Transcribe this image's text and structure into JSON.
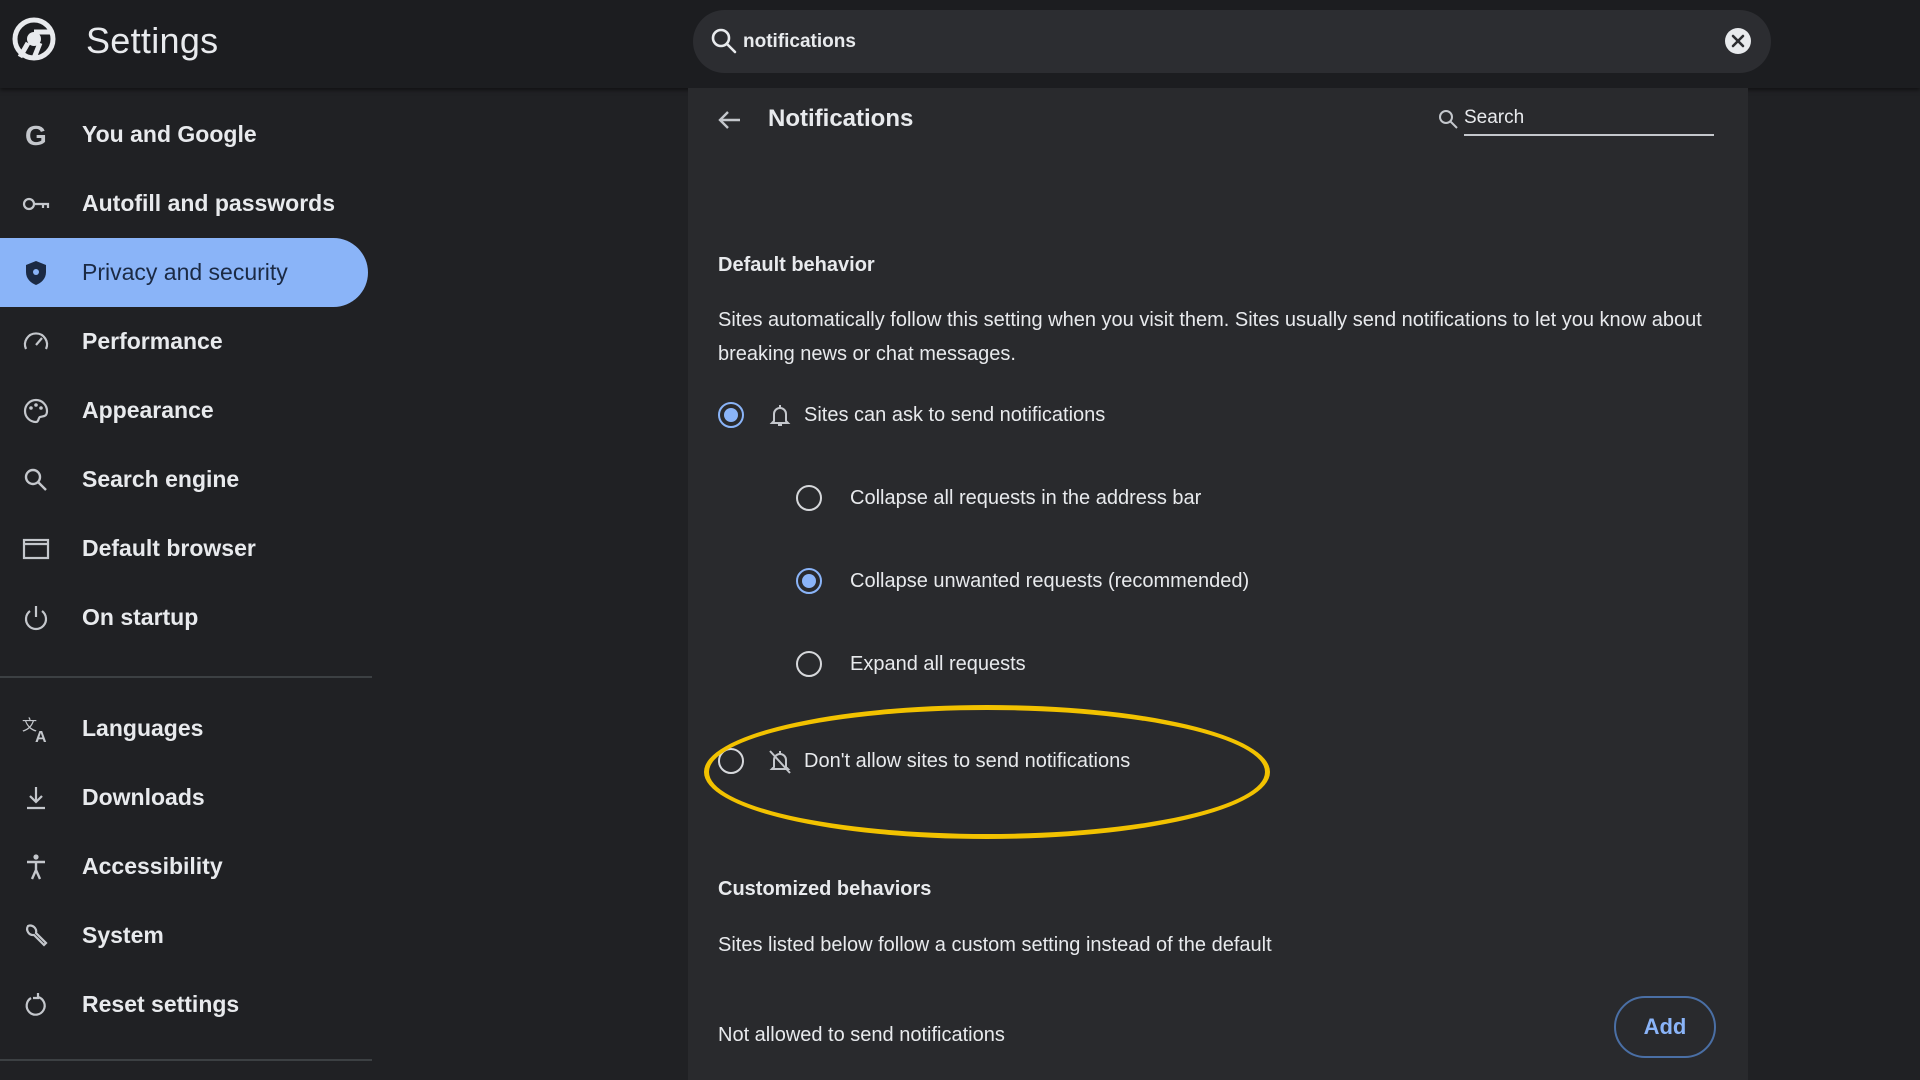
{
  "app": {
    "title": "Settings"
  },
  "search": {
    "value": "notifications"
  },
  "sidebar": {
    "items": [
      {
        "label": "You and Google",
        "icon": "google-icon"
      },
      {
        "label": "Autofill and passwords",
        "icon": "key-icon"
      },
      {
        "label": "Privacy and security",
        "icon": "shield-icon",
        "active": true
      },
      {
        "label": "Performance",
        "icon": "speedometer-icon"
      },
      {
        "label": "Appearance",
        "icon": "palette-icon"
      },
      {
        "label": "Search engine",
        "icon": "search-icon"
      },
      {
        "label": "Default browser",
        "icon": "browser-window-icon"
      },
      {
        "label": "On startup",
        "icon": "power-icon"
      }
    ],
    "items2": [
      {
        "label": "Languages",
        "icon": "translate-icon"
      },
      {
        "label": "Downloads",
        "icon": "download-icon"
      },
      {
        "label": "Accessibility",
        "icon": "accessibility-icon"
      },
      {
        "label": "System",
        "icon": "wrench-icon"
      },
      {
        "label": "Reset settings",
        "icon": "reset-icon"
      }
    ]
  },
  "page": {
    "title": "Notifications",
    "search_placeholder": "Search",
    "default_behavior": {
      "title": "Default behavior",
      "description": "Sites automatically follow this setting when you visit them. Sites usually send notifications to let you know about breaking news or chat messages.",
      "options": [
        {
          "label": "Sites can ask to send notifications",
          "selected": true
        },
        {
          "label": "Collapse all requests in the address bar",
          "selected": false
        },
        {
          "label": "Collapse unwanted requests (recommended)",
          "selected": true
        },
        {
          "label": "Expand all requests",
          "selected": false
        },
        {
          "label": "Don't allow sites to send notifications",
          "selected": false
        }
      ]
    },
    "customized": {
      "title": "Customized behaviors",
      "description": "Sites listed below follow a custom setting instead of the default",
      "not_allowed_label": "Not allowed to send notifications",
      "add_label": "Add"
    }
  },
  "colors": {
    "accent": "#8ab4f8",
    "highlight": "#f2c200",
    "background": "#202124",
    "panel": "#292a2d"
  }
}
